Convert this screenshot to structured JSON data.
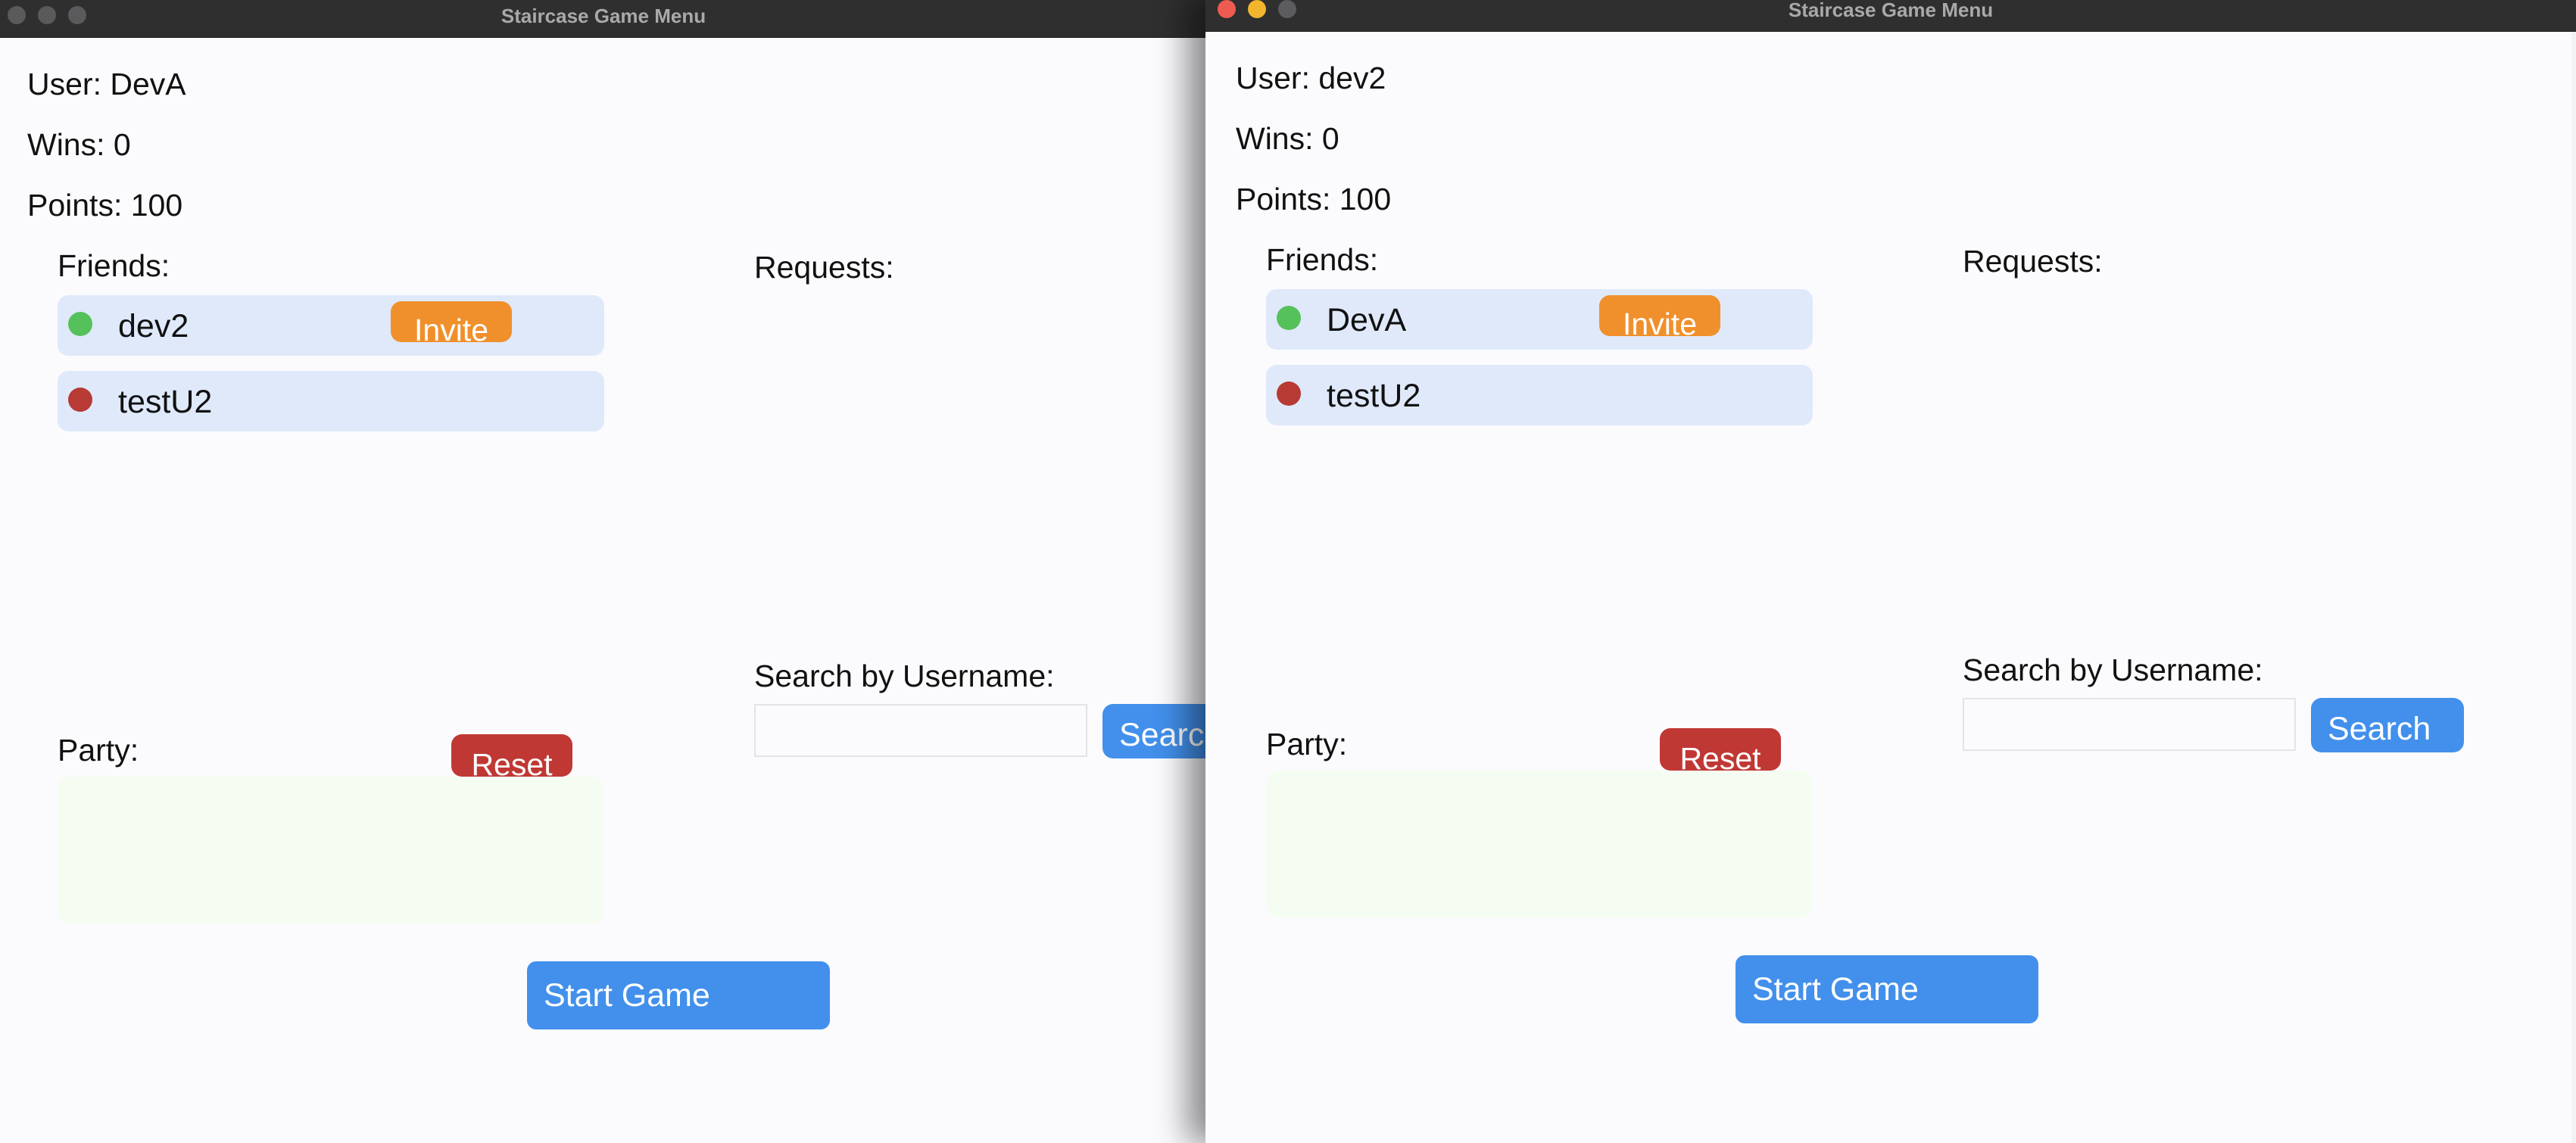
{
  "windows": [
    {
      "id": "left",
      "title": "Staircase Game Menu",
      "user_label": "User: DevA",
      "wins_label": "Wins: 0",
      "points_label": "Points: 100",
      "friends_heading": "Friends:",
      "friends": [
        {
          "name": "dev2",
          "status": "online",
          "invite_label": "Invite"
        },
        {
          "name": "testU2",
          "status": "offline"
        }
      ],
      "requests_heading": "Requests:",
      "search_heading": "Search by Username:",
      "search_value": "",
      "search_button": "Search",
      "party_heading": "Party:",
      "reset_label": "Reset",
      "start_label": "Start Game"
    },
    {
      "id": "right",
      "title": "Staircase Game Menu",
      "user_label": "User: dev2",
      "wins_label": "Wins: 0",
      "points_label": "Points: 100",
      "friends_heading": "Friends:",
      "friends": [
        {
          "name": "DevA",
          "status": "online",
          "invite_label": "Invite"
        },
        {
          "name": "testU2",
          "status": "offline"
        }
      ],
      "requests_heading": "Requests:",
      "search_heading": "Search by Username:",
      "search_value": "",
      "search_button": "Search",
      "party_heading": "Party:",
      "reset_label": "Reset",
      "start_label": "Start Game"
    }
  ],
  "colors": {
    "online": "#55c15a",
    "offline": "#b83a34",
    "invite": "#f0902c",
    "reset": "#c03834",
    "primary": "#4290ec",
    "friend_row": "#dfe9fa",
    "party_box": "#f5fdf2"
  },
  "icons": [
    "close-traffic-light",
    "minimize-traffic-light",
    "zoom-traffic-light",
    "online-status-dot",
    "offline-status-dot"
  ]
}
